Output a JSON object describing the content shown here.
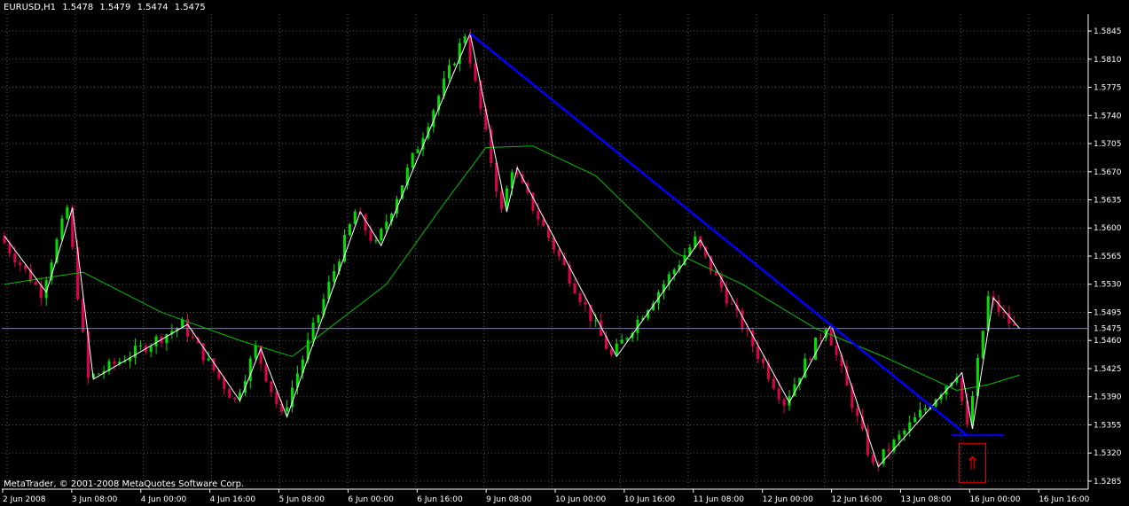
{
  "header": {
    "symbol": "EURUSD,H1",
    "open": "1.5478",
    "high": "1.5479",
    "low": "1.5474",
    "close": "1.5475"
  },
  "footer": {
    "copyright": "MetaTrader, © 2001-2008 MetaQuotes Software Corp."
  },
  "colors": {
    "background": "#000000",
    "grid": "#5a5a5a",
    "axis": "#ffffff",
    "bull_candle": "#00e000",
    "bear_candle": "#e0004c",
    "zigzag": "#ffffff",
    "moving_average": "#00c000",
    "trendline": "#0000ff",
    "bid_line": "#8080a0",
    "signal_box": "#e00000"
  },
  "chart_data": {
    "type": "candlestick",
    "symbol": "EURUSD",
    "timeframe": "H1",
    "ylim": [
      1.5275,
      1.5866
    ],
    "y_ticks": [
      "1.5845",
      "1.5810",
      "1.5775",
      "1.5740",
      "1.5705",
      "1.5670",
      "1.5635",
      "1.5600",
      "1.5565",
      "1.5530",
      "1.5495",
      "1.5460",
      "1.5425",
      "1.5390",
      "1.5355",
      "1.5320",
      "1.5285"
    ],
    "current_price": "1.5475",
    "x_labels": [
      "2 Jun 2008",
      "3 Jun 08:00",
      "4 Jun 00:00",
      "4 Jun 16:00",
      "5 Jun 08:00",
      "6 Jun 00:00",
      "6 Jun 16:00",
      "9 Jun 08:00",
      "10 Jun 00:00",
      "10 Jun 16:00",
      "11 Jun 08:00",
      "12 Jun 00:00",
      "12 Jun 16:00",
      "13 Jun 08:00",
      "16 Jun 00:00",
      "16 Jun 16:00"
    ],
    "bars_total": 194,
    "bars_per_label": 16,
    "zigzag": [
      {
        "bar": 0,
        "price": 1.559
      },
      {
        "bar": 8,
        "price": 1.552
      },
      {
        "bar": 13,
        "price": 1.5625
      },
      {
        "bar": 17,
        "price": 1.5412
      },
      {
        "bar": 35,
        "price": 1.548
      },
      {
        "bar": 45,
        "price": 1.5385
      },
      {
        "bar": 49,
        "price": 1.545
      },
      {
        "bar": 54,
        "price": 1.5365
      },
      {
        "bar": 68,
        "price": 1.562
      },
      {
        "bar": 72,
        "price": 1.5578
      },
      {
        "bar": 89,
        "price": 1.5842
      },
      {
        "bar": 96,
        "price": 1.562
      },
      {
        "bar": 98,
        "price": 1.5675
      },
      {
        "bar": 117,
        "price": 1.544
      },
      {
        "bar": 133,
        "price": 1.5585
      },
      {
        "bar": 150,
        "price": 1.5383
      },
      {
        "bar": 158,
        "price": 1.548
      },
      {
        "bar": 167,
        "price": 1.5303
      },
      {
        "bar": 183,
        "price": 1.542
      },
      {
        "bar": 185,
        "price": 1.535
      },
      {
        "bar": 189,
        "price": 1.5513
      },
      {
        "bar": 194,
        "price": 1.5475
      }
    ],
    "moving_average": [
      {
        "bar": 0,
        "price": 1.553
      },
      {
        "bar": 15,
        "price": 1.5545
      },
      {
        "bar": 30,
        "price": 1.5495
      },
      {
        "bar": 45,
        "price": 1.546
      },
      {
        "bar": 55,
        "price": 1.544
      },
      {
        "bar": 63,
        "price": 1.548
      },
      {
        "bar": 73,
        "price": 1.553
      },
      {
        "bar": 84,
        "price": 1.563
      },
      {
        "bar": 92,
        "price": 1.57
      },
      {
        "bar": 101,
        "price": 1.5702
      },
      {
        "bar": 113,
        "price": 1.5665
      },
      {
        "bar": 128,
        "price": 1.557
      },
      {
        "bar": 141,
        "price": 1.553
      },
      {
        "bar": 155,
        "price": 1.5475
      },
      {
        "bar": 168,
        "price": 1.544
      },
      {
        "bar": 182,
        "price": 1.5398
      },
      {
        "bar": 188,
        "price": 1.5405
      },
      {
        "bar": 194,
        "price": 1.5417
      }
    ],
    "trendline": {
      "from": {
        "bar": 89,
        "price": 1.5842
      },
      "to": {
        "bar": 184,
        "price": 1.5342
      }
    },
    "support_line": {
      "from_bar": 181,
      "to_bar": 191,
      "price": 1.5342
    },
    "signal": {
      "bar": 185,
      "price_top": 1.5332,
      "price_bottom": 1.5283,
      "glyph": "⇑"
    }
  }
}
